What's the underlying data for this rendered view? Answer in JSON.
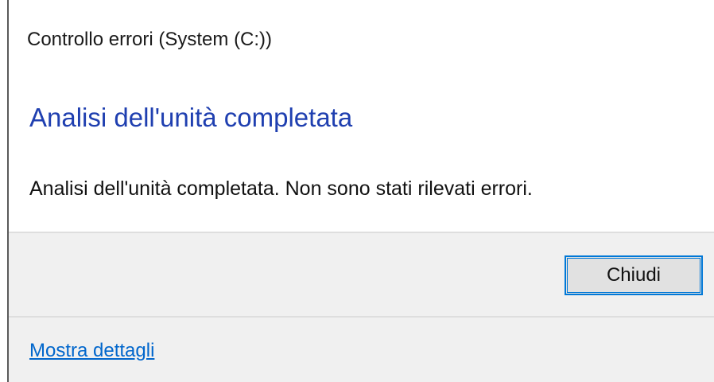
{
  "dialog": {
    "title": "Controllo errori (System (C:))",
    "heading": "Analisi dell'unità completata",
    "message": "Analisi dell'unità completata. Non sono stati rilevati errori.",
    "close_label": "Chiudi",
    "details_link": "Mostra dettagli"
  },
  "colors": {
    "heading": "#1f3fb0",
    "link": "#0066cc",
    "button_focus_border": "#0078d7",
    "panel_background": "#f0f0f0"
  }
}
